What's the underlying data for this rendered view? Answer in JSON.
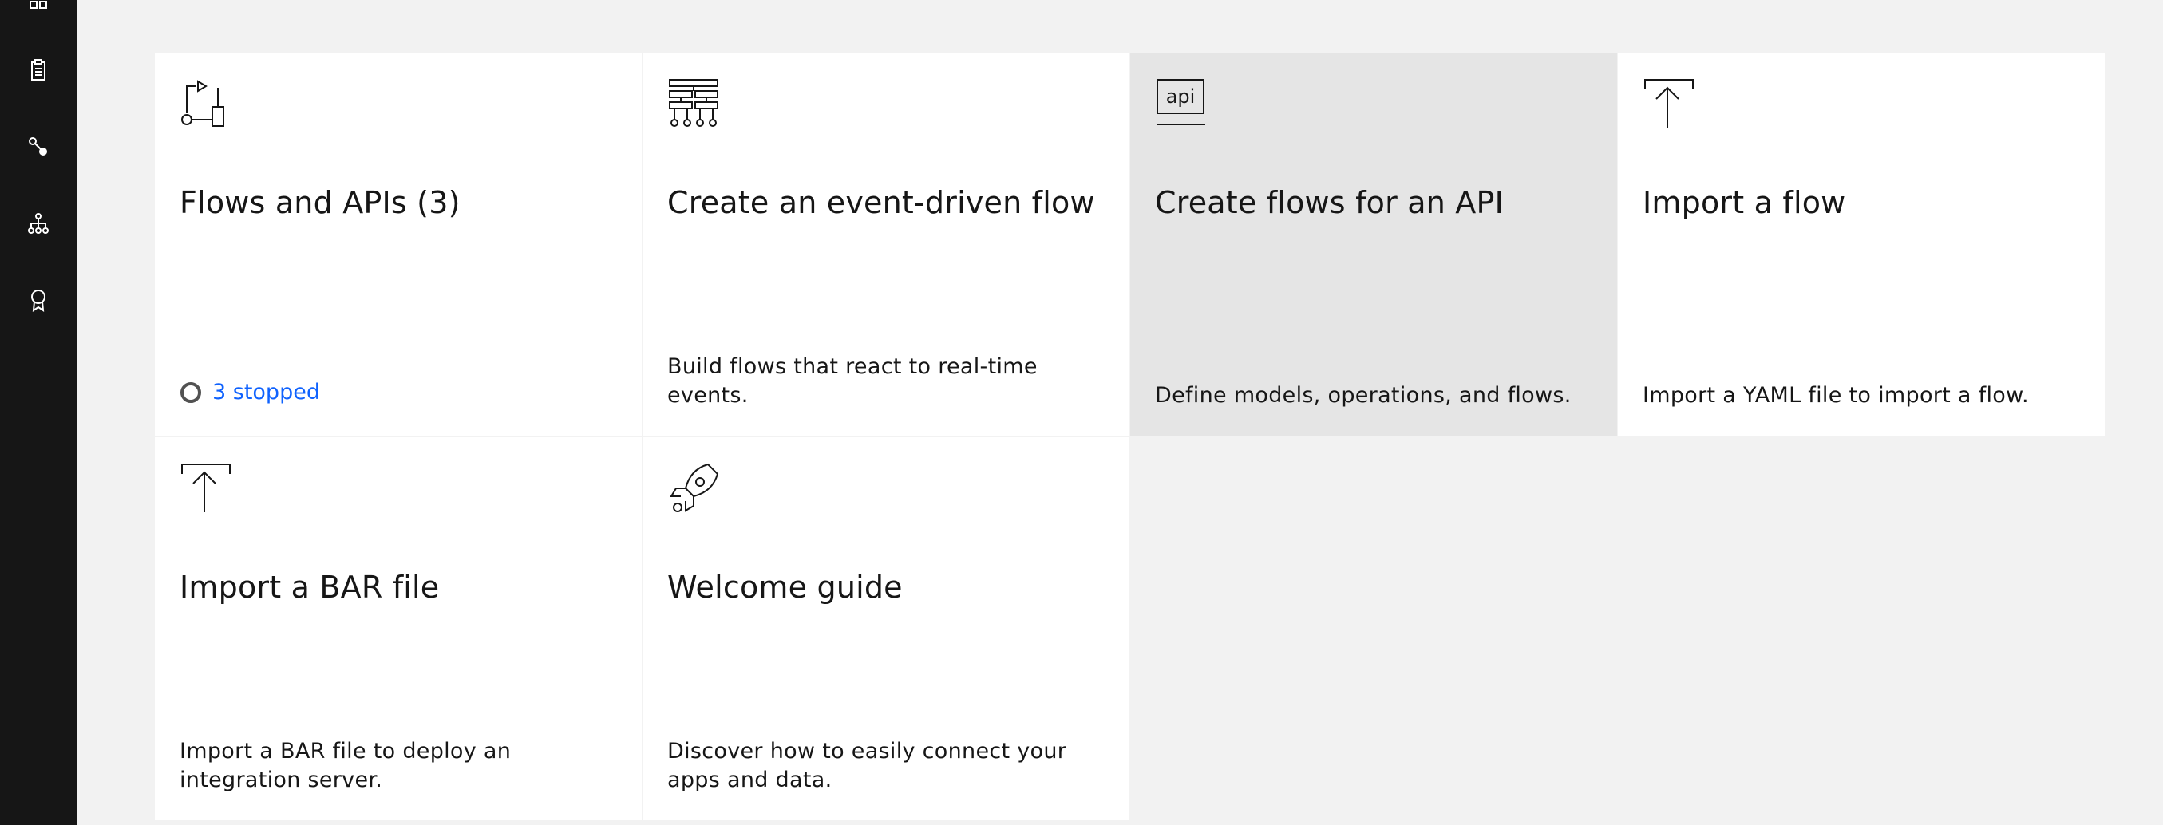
{
  "sidenav": {
    "items": [
      {
        "icon": "dashboard-icon"
      },
      {
        "icon": "clipboard-icon"
      },
      {
        "icon": "connection-icon"
      },
      {
        "icon": "hierarchy-icon"
      },
      {
        "icon": "badge-icon"
      }
    ]
  },
  "tiles": [
    {
      "icon": "flow-icon",
      "title": "Flows and APIs (3)",
      "status": {
        "label": "3 stopped",
        "color": "#0f62fe"
      }
    },
    {
      "icon": "event-flow-icon",
      "title": "Create an event-driven flow",
      "description": "Build flows that react to real-time events."
    },
    {
      "icon": "api-icon",
      "icon_text": "api",
      "title": "Create flows for an API",
      "description": "Define models, operations, and flows."
    },
    {
      "icon": "upload-icon",
      "title": "Import a flow",
      "description": "Import a YAML file to import a flow."
    },
    {
      "icon": "upload-icon",
      "title": "Import a BAR file",
      "description": "Import a BAR file to deploy an integration server."
    },
    {
      "icon": "rocket-icon",
      "title": "Welcome guide",
      "description": "Discover how to easily connect your apps and data."
    }
  ],
  "colors": {
    "page_bg": "#f2f2f2",
    "sidenav_bg": "#161616",
    "tile_bg": "#ffffff",
    "tile_hover_bg": "#e5e5e5",
    "link": "#0f62fe"
  }
}
